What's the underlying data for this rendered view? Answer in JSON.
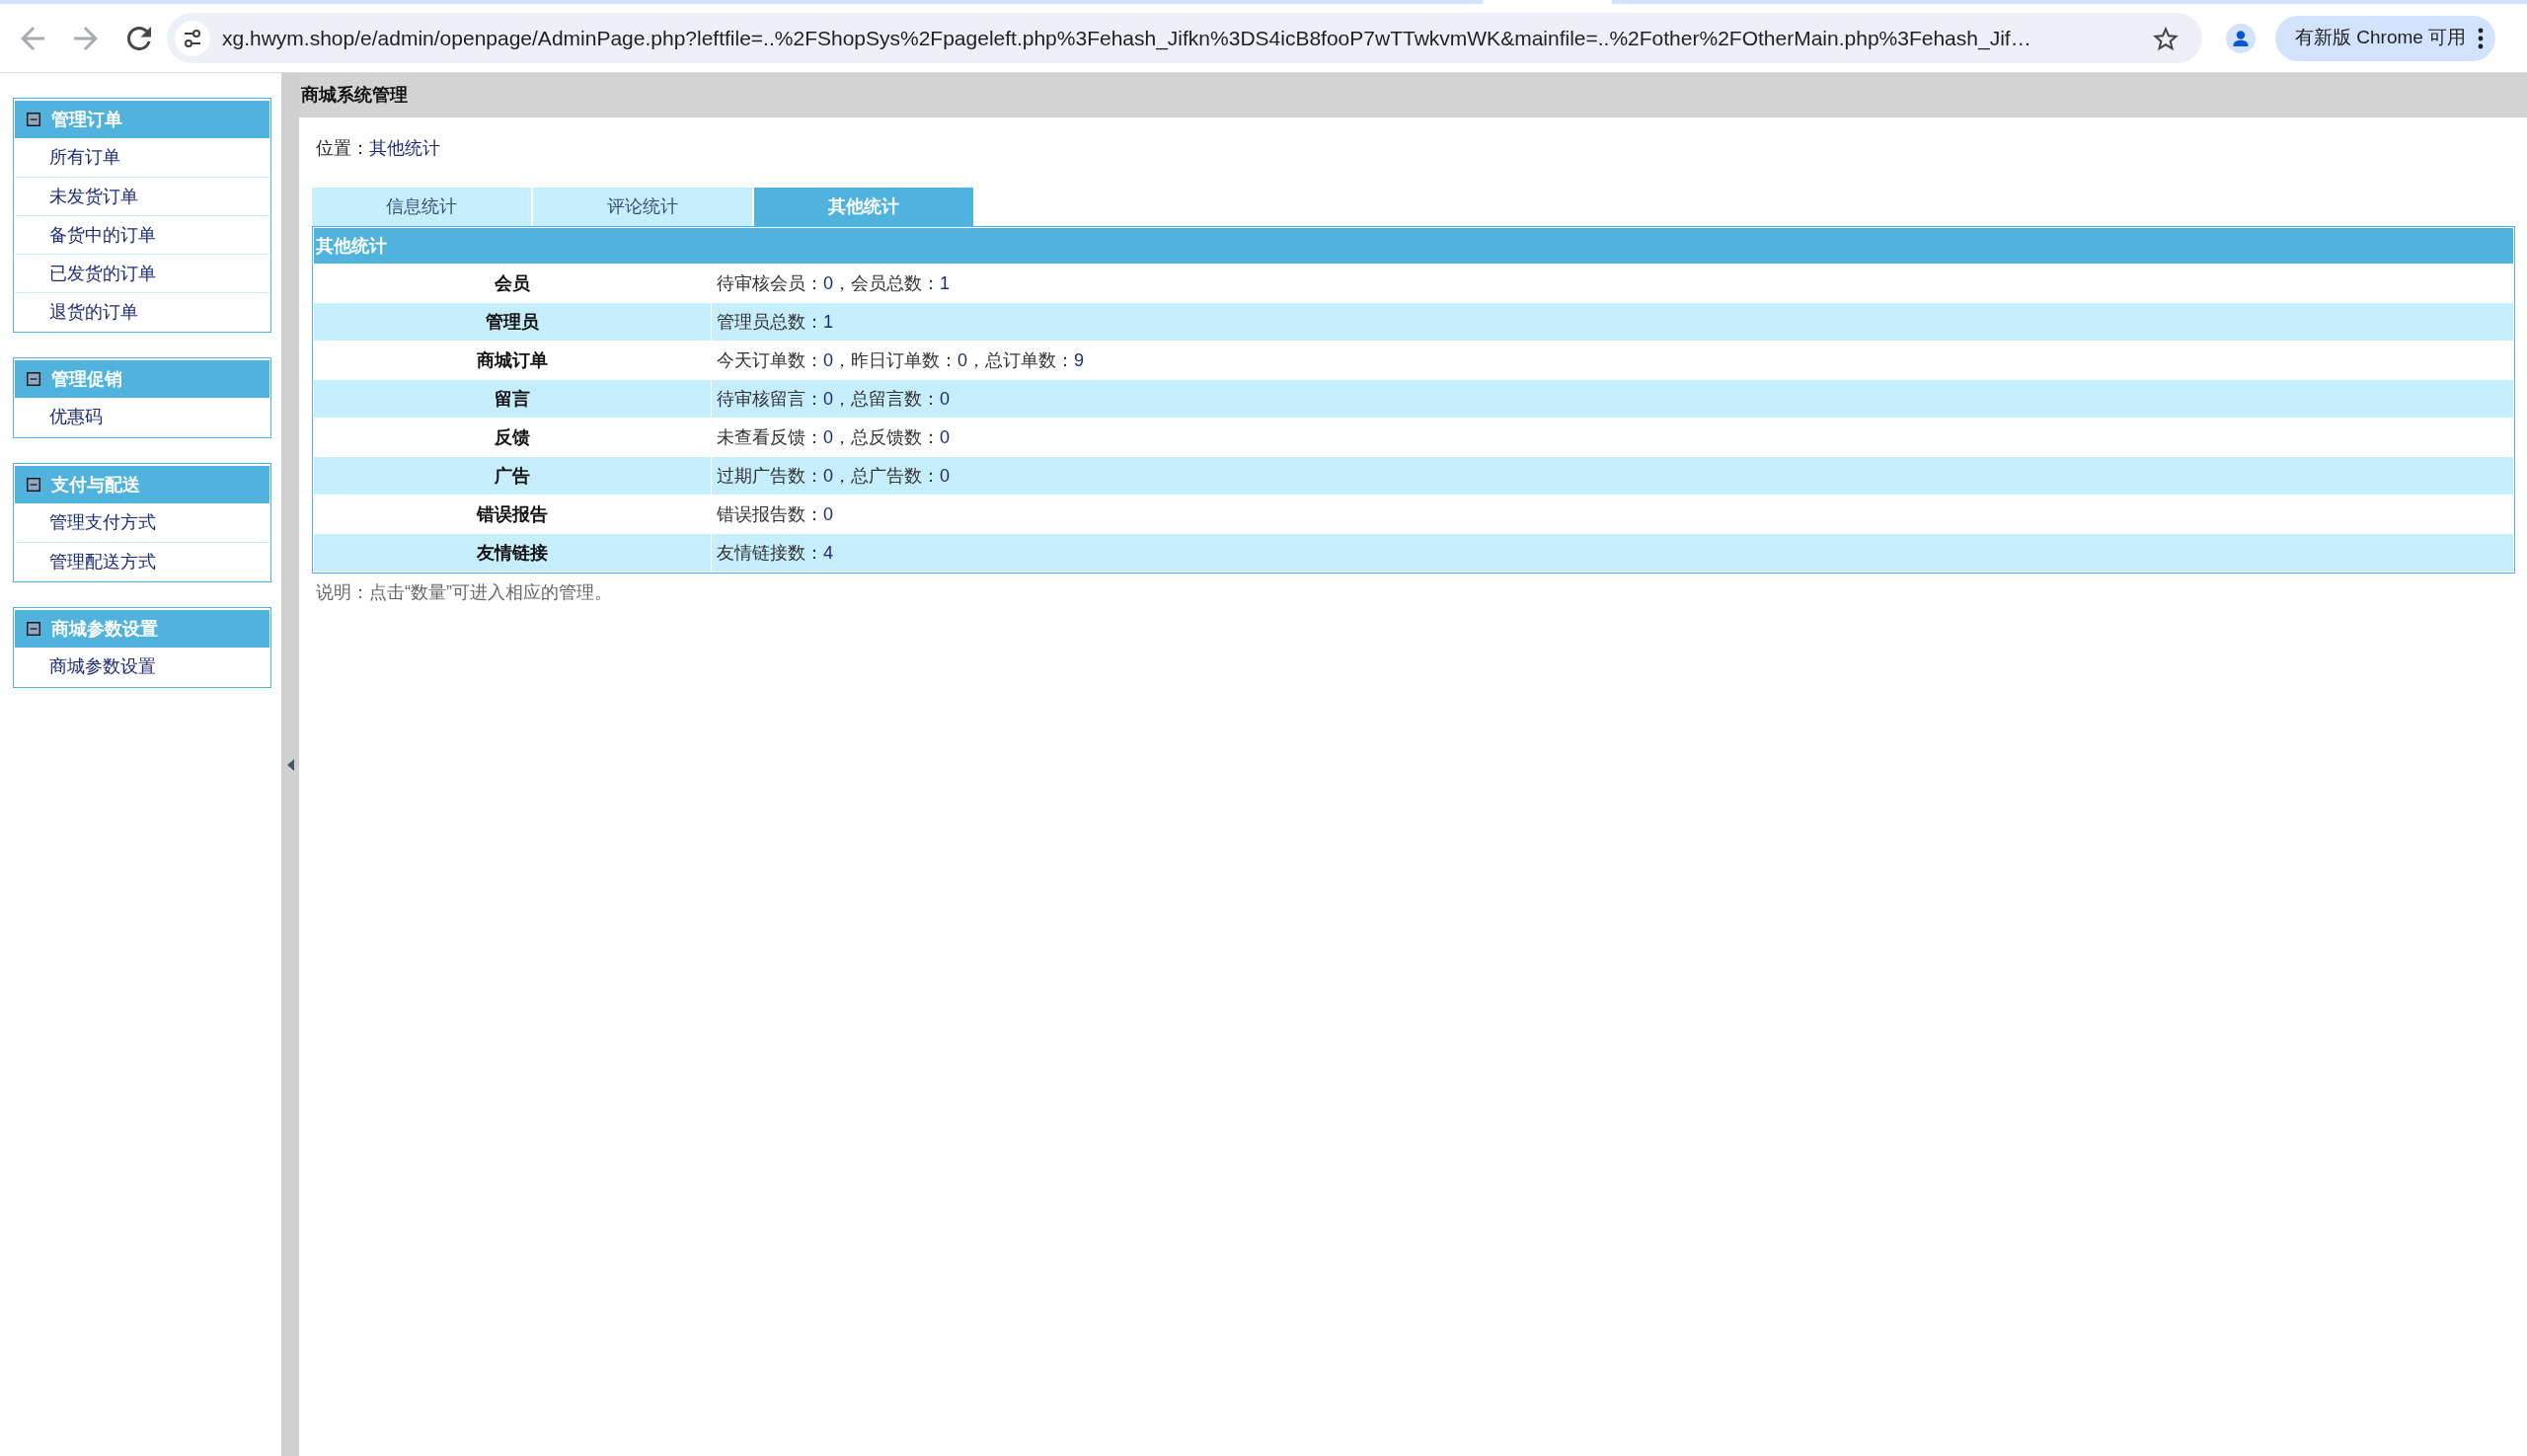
{
  "browser": {
    "url": "xg.hwym.shop/e/admin/openpage/AdminPage.php?leftfile=..%2FShopSys%2Fpageleft.php%3Fehash_Jifkn%3DS4icB8fooP7wTTwkvmWK&mainfile=..%2Fother%2FOtherMain.php%3Fehash_Jif…",
    "update_button": "有新版 Chrome 可用"
  },
  "sidebar": {
    "groups": [
      {
        "title": "管理订单",
        "expanded": true,
        "items": [
          "所有订单",
          "未发货订单",
          "备货中的订单",
          "已发货的订单",
          "退货的订单"
        ]
      },
      {
        "title": "管理促销",
        "expanded": true,
        "items": [
          "优惠码"
        ]
      },
      {
        "title": "支付与配送",
        "expanded": true,
        "items": [
          "管理支付方式",
          "管理配送方式"
        ]
      },
      {
        "title": "商城参数设置",
        "expanded": true,
        "items": [
          "商城参数设置"
        ]
      }
    ]
  },
  "header": {
    "title": "商城系统管理"
  },
  "breadcrumb": {
    "label": "位置：",
    "current": "其他统计"
  },
  "tabs": [
    {
      "label": "信息统计",
      "selected": false
    },
    {
      "label": "评论统计",
      "selected": false
    },
    {
      "label": "其他统计",
      "selected": true
    }
  ],
  "table": {
    "title": "其他统计",
    "rows": [
      {
        "label": "会员",
        "value": [
          {
            "kind": "text",
            "text": "待审核会员："
          },
          {
            "kind": "count",
            "text": "0"
          },
          {
            "kind": "text",
            "text": "，会员总数："
          },
          {
            "kind": "count",
            "text": "1"
          }
        ]
      },
      {
        "label": "管理员",
        "value": [
          {
            "kind": "text",
            "text": "管理员总数："
          },
          {
            "kind": "count",
            "text": "1"
          }
        ]
      },
      {
        "label": "商城订单",
        "value": [
          {
            "kind": "text",
            "text": "今天订单数："
          },
          {
            "kind": "count",
            "text": "0"
          },
          {
            "kind": "text",
            "text": "，昨日订单数："
          },
          {
            "kind": "count",
            "text": "0"
          },
          {
            "kind": "text",
            "text": "，总订单数："
          },
          {
            "kind": "count",
            "text": "9"
          }
        ]
      },
      {
        "label": "留言",
        "value": [
          {
            "kind": "text",
            "text": "待审核留言："
          },
          {
            "kind": "count",
            "text": "0"
          },
          {
            "kind": "text",
            "text": "，总留言数："
          },
          {
            "kind": "count",
            "text": "0"
          }
        ]
      },
      {
        "label": "反馈",
        "value": [
          {
            "kind": "text",
            "text": "未查看反馈："
          },
          {
            "kind": "count",
            "text": "0"
          },
          {
            "kind": "text",
            "text": "，总反馈数："
          },
          {
            "kind": "count",
            "text": "0"
          }
        ]
      },
      {
        "label": "广告",
        "value": [
          {
            "kind": "text",
            "text": "过期广告数："
          },
          {
            "kind": "count",
            "text": "0"
          },
          {
            "kind": "text",
            "text": "，总广告数："
          },
          {
            "kind": "count",
            "text": "0"
          }
        ]
      },
      {
        "label": "错误报告",
        "value": [
          {
            "kind": "text",
            "text": "错误报告数："
          },
          {
            "kind": "count",
            "text": "0"
          }
        ]
      },
      {
        "label": "友情链接",
        "value": [
          {
            "kind": "text",
            "text": "友情链接数："
          },
          {
            "kind": "count",
            "text": "4"
          }
        ]
      }
    ]
  },
  "note": "说明：点击“数量”可进入相应的管理。"
}
